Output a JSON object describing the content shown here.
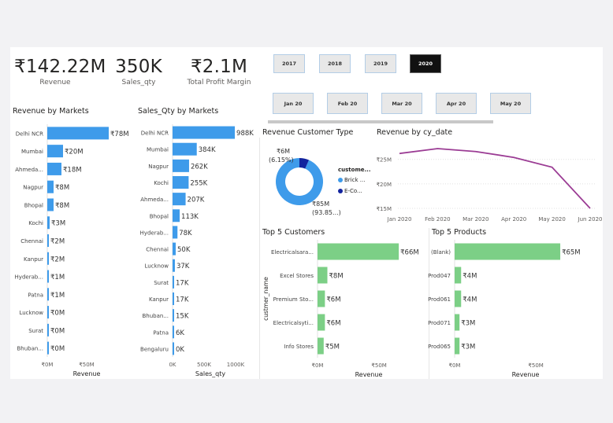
{
  "kpis": {
    "revenue": {
      "value": "₹142.22M",
      "label": "Revenue"
    },
    "sales_qty": {
      "value": "350K",
      "label": "Sales_qty"
    },
    "profit": {
      "value": "₹2.1M",
      "label": "Total Profit Margin"
    }
  },
  "slicers": {
    "years": [
      "2017",
      "2018",
      "2019",
      "2020"
    ],
    "selected_year": "2020",
    "months": [
      "Jan 20",
      "Feb 20",
      "Mar 20",
      "Apr 20",
      "May 20"
    ]
  },
  "colors": {
    "blue": "#3e9bea",
    "green": "#7ccf86",
    "purple": "#9b3c94",
    "dark_blue": "#12239e"
  },
  "chart_data": [
    {
      "id": "revenue-by-markets",
      "type": "bar",
      "title": "Revenue by Markets",
      "xlabel": "Revenue",
      "ylabel": "",
      "xlim": [
        0,
        100
      ],
      "ticks": [
        "₹0M",
        "₹50M"
      ],
      "tick_values": [
        0,
        50
      ],
      "categories": [
        "Delhi NCR",
        "Mumbai",
        "Ahmeda...",
        "Nagpur",
        "Bhopal",
        "Kochi",
        "Chennai",
        "Kanpur",
        "Hyderab...",
        "Patna",
        "Lucknow",
        "Surat",
        "Bhuban..."
      ],
      "values": [
        78,
        20,
        18,
        8,
        8,
        3,
        2,
        2,
        1,
        1,
        0.4,
        0.3,
        0.2
      ],
      "labels": [
        "₹78M",
        "₹20M",
        "₹18M",
        "₹8M",
        "₹8M",
        "₹3M",
        "₹2M",
        "₹2M",
        "₹1M",
        "₹1M",
        "₹0M",
        "₹0M",
        "₹0M"
      ]
    },
    {
      "id": "sales-qty-by-markets",
      "type": "bar",
      "title": "Sales_Qty by Markets",
      "xlabel": "Sales_qty",
      "ylabel": "",
      "xlim": [
        0,
        1000
      ],
      "ticks": [
        "0K",
        "500K",
        "1000K"
      ],
      "tick_values": [
        0,
        500,
        1000
      ],
      "categories": [
        "Delhi NCR",
        "Mumbai",
        "Nagpur",
        "Kochi",
        "Ahmeda...",
        "Bhopal",
        "Hyderab...",
        "Chennai",
        "Lucknow",
        "Surat",
        "Kanpur",
        "Bhuban...",
        "Patna",
        "Bengaluru"
      ],
      "values": [
        988,
        384,
        262,
        255,
        207,
        113,
        78,
        50,
        37,
        17,
        17,
        15,
        6,
        0.4
      ],
      "labels": [
        "988K",
        "384K",
        "262K",
        "255K",
        "207K",
        "113K",
        "78K",
        "50K",
        "37K",
        "17K",
        "17K",
        "15K",
        "6K",
        "0K"
      ]
    },
    {
      "id": "revenue-customer-type",
      "type": "pie",
      "title": "Revenue Customer Type",
      "legend_title": "custome...",
      "slices": [
        {
          "name": "Brick ...",
          "value": 85,
          "percent": 93.85,
          "label_value": "₹85M",
          "label_pct": "(93.85...)",
          "color": "#3e9bea"
        },
        {
          "name": "E-Co...",
          "value": 6,
          "percent": 6.15,
          "label_value": "₹6M",
          "label_pct": "(6.15%)",
          "color": "#12239e"
        }
      ]
    },
    {
      "id": "revenue-by-cy-date",
      "type": "line",
      "title": "Revenue by cy_date",
      "x": [
        "Jan 2020",
        "Feb 2020",
        "Mar 2020",
        "Apr 2020",
        "May 2020",
        "Jun 2020"
      ],
      "y": [
        26.2,
        27.2,
        26.6,
        25.4,
        23.4,
        15
      ],
      "ylim": [
        15,
        28
      ],
      "yticks": [
        "₹25M",
        "₹20M",
        "₹15M"
      ],
      "ytick_values": [
        25,
        20,
        15
      ]
    },
    {
      "id": "top-5-customers",
      "type": "bar",
      "title": "Top 5 Customers",
      "xlabel": "Revenue",
      "ylabel": "custmer_name",
      "xlim": [
        0,
        80
      ],
      "ticks": [
        "₹0M",
        "₹50M"
      ],
      "tick_values": [
        0,
        50
      ],
      "categories": [
        "Electricalsara...",
        "Excel Stores",
        "Premium Sto...",
        "Electricalsyti...",
        "Info Stores"
      ],
      "values": [
        66,
        8,
        6,
        6,
        5
      ],
      "labels": [
        "₹66M",
        "₹8M",
        "₹6M",
        "₹6M",
        "₹5M"
      ]
    },
    {
      "id": "top-5-products",
      "type": "bar",
      "title": "Top 5 Products",
      "xlabel": "Revenue",
      "ylabel": "",
      "xlim": [
        0,
        80
      ],
      "ticks": [
        "₹0M",
        "₹50M"
      ],
      "tick_values": [
        0,
        50
      ],
      "categories": [
        "(Blank)",
        "Prod047",
        "Prod061",
        "Prod071",
        "Prod065"
      ],
      "values": [
        65,
        4,
        4,
        3,
        3
      ],
      "labels": [
        "₹65M",
        "₹4M",
        "₹4M",
        "₹3M",
        "₹3M"
      ]
    }
  ]
}
